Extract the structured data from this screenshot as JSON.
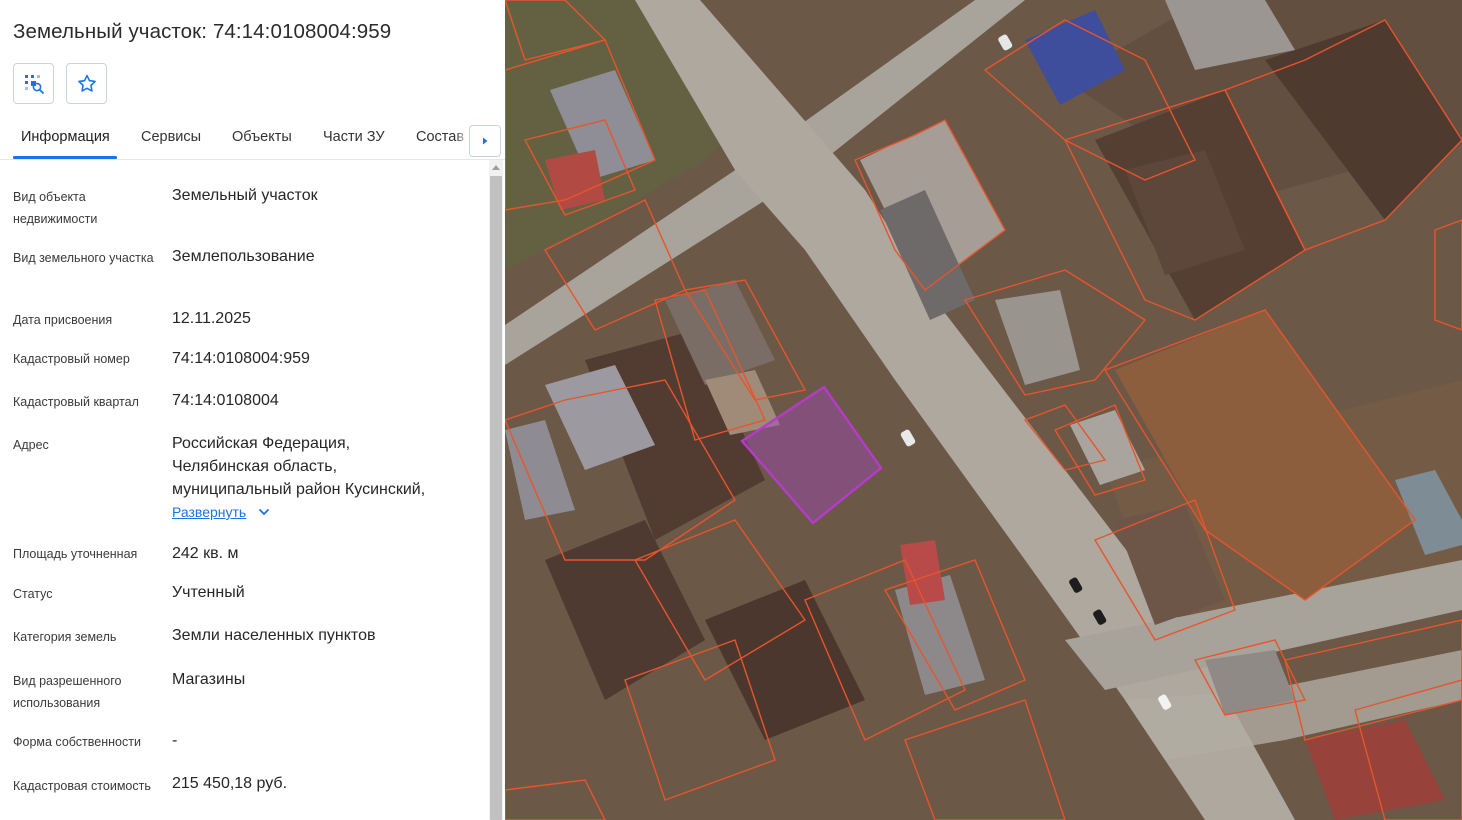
{
  "title": "Земельный участок: 74:14:0108004:959",
  "toolbar": {
    "locate_icon": "map-search-icon",
    "favorite_icon": "star-icon"
  },
  "tabs": [
    {
      "label": "Информация",
      "active": true
    },
    {
      "label": "Сервисы"
    },
    {
      "label": "Объекты"
    },
    {
      "label": "Части ЗУ"
    },
    {
      "label": "Состав"
    }
  ],
  "info": {
    "object_type": {
      "label": "Вид объекта недвижимости",
      "value": "Земельный участок"
    },
    "land_type": {
      "label": "Вид земельного участка",
      "value": "Землепользование"
    },
    "date": {
      "label": "Дата присвоения",
      "value": "12.11.2025"
    },
    "cadastral_number": {
      "label": "Кадастровый номер",
      "value": "74:14:0108004:959"
    },
    "cadastral_quarter": {
      "label": "Кадастровый квартал",
      "value": "74:14:0108004"
    },
    "address": {
      "label": "Адрес",
      "line1": "Российская Федерация,",
      "line2": "Челябинская область,",
      "line3": "муниципальный район Кусинский,",
      "expand": "Развернуть"
    },
    "area": {
      "label": "Площадь уточненная",
      "value": "242 кв. м"
    },
    "status": {
      "label": "Статус",
      "value": "Учтенный"
    },
    "category": {
      "label": "Категория земель",
      "value": "Земли населенных пунктов"
    },
    "permitted_use": {
      "label": "Вид разрешенного использования",
      "value": "Магазины"
    },
    "ownership": {
      "label": "Форма собственности",
      "value": "-"
    },
    "cadastral_value": {
      "label": "Кадастровая стоимость",
      "value": "215 450,18 руб."
    }
  },
  "colors": {
    "accent": "#1a73e8",
    "parcel_outline": "#e8542c",
    "selected_parcel": "#b43cc8"
  }
}
